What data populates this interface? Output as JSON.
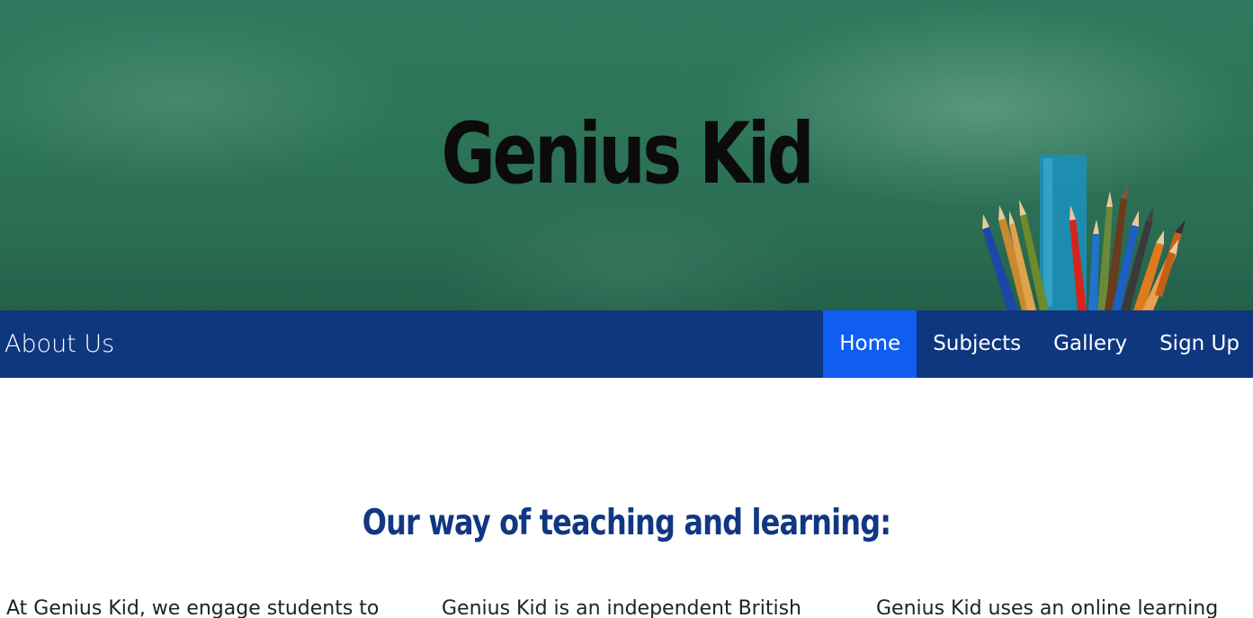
{
  "hero": {
    "title": "Genius Kid"
  },
  "navbar": {
    "brand": "About Us",
    "links": [
      {
        "label": "Home",
        "active": true
      },
      {
        "label": "Subjects",
        "active": false
      },
      {
        "label": "Gallery",
        "active": false
      },
      {
        "label": "Sign Up",
        "active": false
      }
    ]
  },
  "main": {
    "heading": "Our way of teaching and learning:",
    "columns": [
      {
        "text": "At Genius Kid, we engage students to"
      },
      {
        "text": "Genius Kid is an independent British"
      },
      {
        "text": "Genius Kid uses an online learning"
      }
    ]
  },
  "colors": {
    "chalkboard": "#2d7559",
    "navbar": "#0f3780",
    "nav_active": "#0f5ef0",
    "heading": "#113783"
  }
}
